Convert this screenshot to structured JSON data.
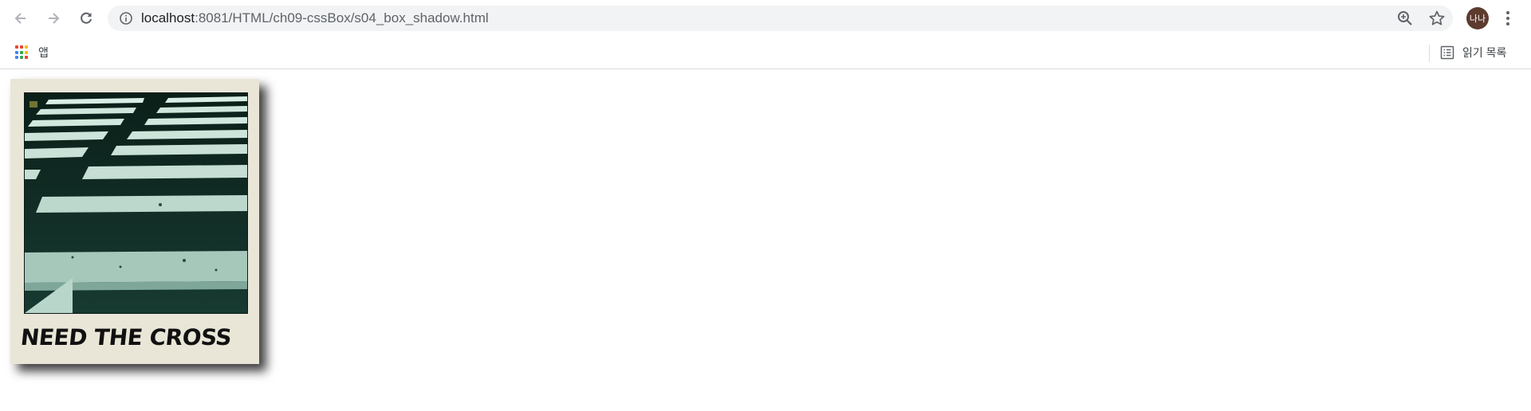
{
  "browser": {
    "url_host": "localhost",
    "url_path": ":8081/HTML/ch09-cssBox/s04_box_shadow.html",
    "avatar_text": "나나",
    "bookmarks": {
      "apps_label": "앱",
      "reading_list_label": "읽기 목록"
    },
    "icons": [
      "back-icon",
      "forward-icon",
      "reload-icon",
      "info-icon",
      "zoom-icon",
      "star-icon",
      "menu-icon",
      "apps-grid-icon",
      "reading-list-icon"
    ]
  },
  "page": {
    "card": {
      "caption": "NEED THE CROSS"
    }
  },
  "colors": {
    "card_bg": "#e9e6d8",
    "photo_dark": "#0f2a22",
    "stripe": "#cfe6dc"
  }
}
